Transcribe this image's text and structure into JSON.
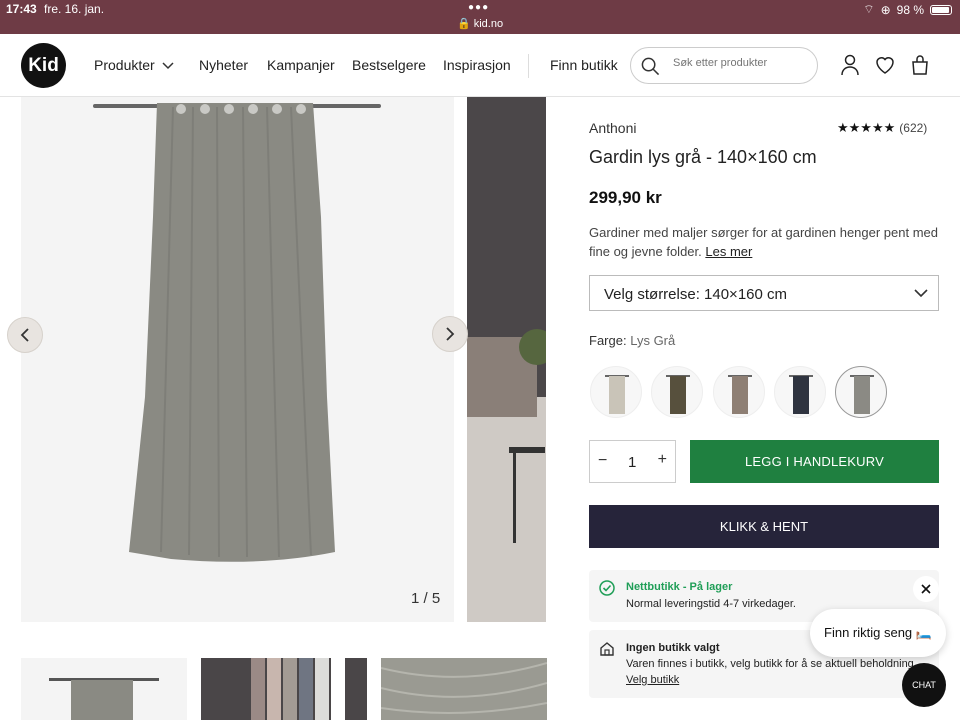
{
  "status_bar": {
    "time": "17:43",
    "date": "fre. 16. jan.",
    "url": "kid.no",
    "battery": "98 %"
  },
  "header": {
    "logo": "Kid",
    "nav": [
      "Produkter",
      "Nyheter",
      "Kampanjer",
      "Bestselgere",
      "Inspirasjon",
      "Finn butikk"
    ],
    "search_placeholder": "Søk etter produkter"
  },
  "gallery": {
    "counter": "1 / 5"
  },
  "product": {
    "brand": "Anthoni",
    "rating_count": "(622)",
    "title": "Gardin lys grå - 140×160 cm",
    "price": "299,90 kr",
    "description": "Gardiner med maljer sørger for at gardinen henger pent med fine og jevne folder.",
    "read_more": "Les mer",
    "size_select": "Velg størrelse: 140×160 cm",
    "color_label": "Farge:",
    "color_value": "Lys Grå",
    "swatches": [
      {
        "name": "beige",
        "color": "#c9c4b8"
      },
      {
        "name": "oliven",
        "color": "#57503d"
      },
      {
        "name": "taupe",
        "color": "#8e7f74"
      },
      {
        "name": "mørkeblå",
        "color": "#2f3440"
      },
      {
        "name": "lys grå",
        "color": "#8b8a84"
      }
    ],
    "quantity": "1",
    "add_to_cart": "LEGG I HANDLEKURV",
    "click_collect": "KLIKK & HENT"
  },
  "stock": {
    "title": "Nettbutikk - På lager",
    "delivery": "Normal leveringstid 4-7 virkedager."
  },
  "store": {
    "title": "Ingen butikk valgt",
    "text": "Varen finnes i butikk, velg butikk for å se aktuell beholdning",
    "link": "Velg butikk"
  },
  "popup": {
    "bed": "Finn riktig seng 🛏️"
  },
  "chat": {
    "label": "CHAT"
  }
}
